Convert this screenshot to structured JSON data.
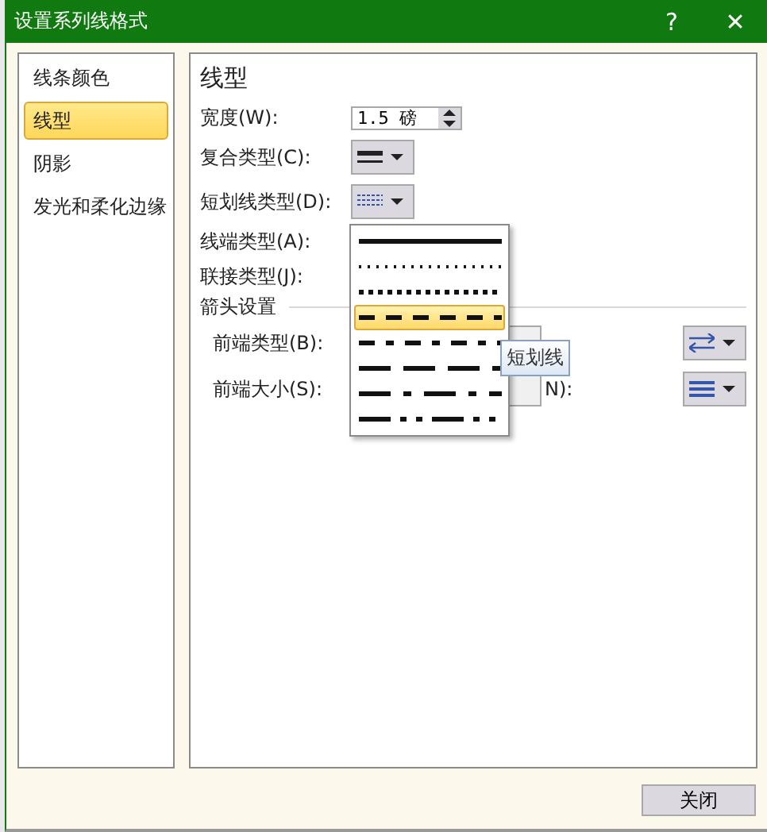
{
  "window": {
    "title": "设置系列线格式",
    "help": "?",
    "close": "✕"
  },
  "sidebar": {
    "items": [
      {
        "label": "线条颜色",
        "selected": false
      },
      {
        "label": "线型",
        "selected": true
      },
      {
        "label": "阴影",
        "selected": false
      },
      {
        "label": "发光和柔化边缘",
        "selected": false
      }
    ]
  },
  "panel": {
    "heading": "线型",
    "width": {
      "label": "宽度(W):",
      "value": "1.5 磅"
    },
    "compound_type": {
      "label": "复合类型(C):"
    },
    "dash_type": {
      "label": "短划线类型(D):"
    },
    "cap_type": {
      "label": "线端类型(A):"
    },
    "join_type": {
      "label": "联接类型(J):"
    },
    "arrow_settings": {
      "heading": "箭头设置",
      "begin_type": {
        "label": "前端类型(B):"
      },
      "begin_size": {
        "label": "前端大小(S):"
      },
      "end_size": {
        "label_visible": "N):"
      }
    }
  },
  "dash_menu": {
    "items": [
      {
        "kind": "solid",
        "selected": false
      },
      {
        "kind": "round-dot",
        "selected": false
      },
      {
        "kind": "square-dot",
        "selected": false
      },
      {
        "kind": "dash",
        "selected": true
      },
      {
        "kind": "dash-dot",
        "selected": false
      },
      {
        "kind": "long-dash",
        "selected": false
      },
      {
        "kind": "long-dash-dot",
        "selected": false
      },
      {
        "kind": "long-dash-dot-dot",
        "selected": false
      }
    ],
    "tooltip": "短划线"
  },
  "buttons": [
    "关闭"
  ]
}
